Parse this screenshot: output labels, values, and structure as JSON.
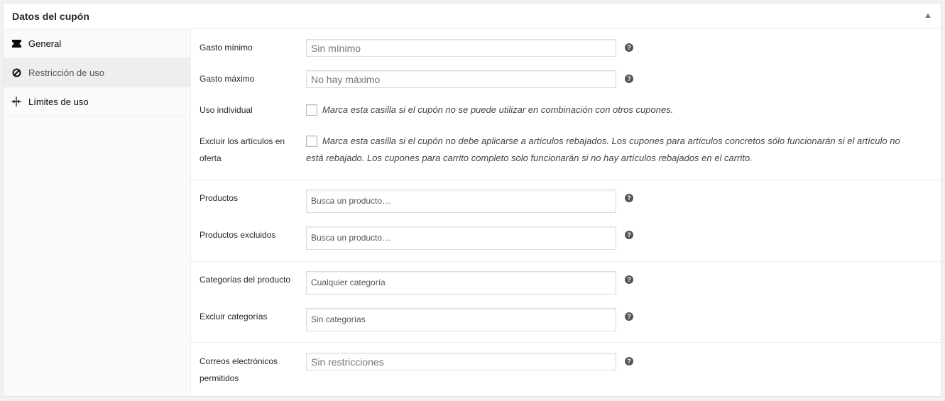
{
  "panel": {
    "title": "Datos del cupón"
  },
  "tabs": [
    {
      "label": "General",
      "icon": "ticket-icon"
    },
    {
      "label": "Restricción de uso",
      "icon": "block-icon"
    },
    {
      "label": "Límites de uso",
      "icon": "limits-icon"
    }
  ],
  "fields": {
    "minimum_spend": {
      "label": "Gasto mínimo",
      "placeholder": "Sin mínimo"
    },
    "maximum_spend": {
      "label": "Gasto máximo",
      "placeholder": "No hay máximo"
    },
    "individual_use": {
      "label": "Uso individual",
      "description": "Marca esta casilla si el cupón no se puede utilizar en combinación con otros cupones."
    },
    "exclude_sale_items": {
      "label_line1": "Excluir los artículos en",
      "label_line2": "oferta",
      "description_line1": "Marca esta casilla si el cupón no debe aplicarse a artículos rebajados. Los cupones para artículos concretos sólo funcionarán si el artículo no",
      "description_line2": "está rebajado. Los cupones para carrito completo solo funcionarán si no hay artículos rebajados en el carrito."
    },
    "products": {
      "label": "Productos",
      "placeholder": "Busca un producto…"
    },
    "exclude_products": {
      "label": "Productos excluidos",
      "placeholder": "Busca un producto…"
    },
    "product_categories": {
      "label": "Categorías del producto",
      "placeholder": "Cualquier categoría"
    },
    "exclude_categories": {
      "label": "Excluir categorías",
      "placeholder": "Sin categorías"
    },
    "allowed_emails": {
      "label_line1": "Correos electrónicos",
      "label_line2": "permitidos",
      "placeholder": "Sin restricciones"
    }
  },
  "help_glyph": "?",
  "colors": {
    "help_icon": "#555555",
    "active_tab_bg": "#eeeeee"
  }
}
